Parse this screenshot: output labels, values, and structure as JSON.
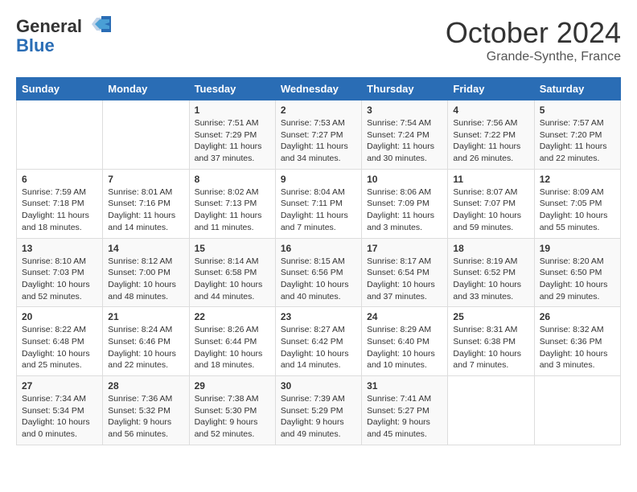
{
  "header": {
    "logo_general": "General",
    "logo_blue": "Blue",
    "title": "October 2024",
    "location": "Grande-Synthe, France"
  },
  "days_of_week": [
    "Sunday",
    "Monday",
    "Tuesday",
    "Wednesday",
    "Thursday",
    "Friday",
    "Saturday"
  ],
  "weeks": [
    [
      null,
      null,
      {
        "day": "1",
        "sunrise": "Sunrise: 7:51 AM",
        "sunset": "Sunset: 7:29 PM",
        "daylight": "Daylight: 11 hours and 37 minutes."
      },
      {
        "day": "2",
        "sunrise": "Sunrise: 7:53 AM",
        "sunset": "Sunset: 7:27 PM",
        "daylight": "Daylight: 11 hours and 34 minutes."
      },
      {
        "day": "3",
        "sunrise": "Sunrise: 7:54 AM",
        "sunset": "Sunset: 7:24 PM",
        "daylight": "Daylight: 11 hours and 30 minutes."
      },
      {
        "day": "4",
        "sunrise": "Sunrise: 7:56 AM",
        "sunset": "Sunset: 7:22 PM",
        "daylight": "Daylight: 11 hours and 26 minutes."
      },
      {
        "day": "5",
        "sunrise": "Sunrise: 7:57 AM",
        "sunset": "Sunset: 7:20 PM",
        "daylight": "Daylight: 11 hours and 22 minutes."
      }
    ],
    [
      {
        "day": "6",
        "sunrise": "Sunrise: 7:59 AM",
        "sunset": "Sunset: 7:18 PM",
        "daylight": "Daylight: 11 hours and 18 minutes."
      },
      {
        "day": "7",
        "sunrise": "Sunrise: 8:01 AM",
        "sunset": "Sunset: 7:16 PM",
        "daylight": "Daylight: 11 hours and 14 minutes."
      },
      {
        "day": "8",
        "sunrise": "Sunrise: 8:02 AM",
        "sunset": "Sunset: 7:13 PM",
        "daylight": "Daylight: 11 hours and 11 minutes."
      },
      {
        "day": "9",
        "sunrise": "Sunrise: 8:04 AM",
        "sunset": "Sunset: 7:11 PM",
        "daylight": "Daylight: 11 hours and 7 minutes."
      },
      {
        "day": "10",
        "sunrise": "Sunrise: 8:06 AM",
        "sunset": "Sunset: 7:09 PM",
        "daylight": "Daylight: 11 hours and 3 minutes."
      },
      {
        "day": "11",
        "sunrise": "Sunrise: 8:07 AM",
        "sunset": "Sunset: 7:07 PM",
        "daylight": "Daylight: 10 hours and 59 minutes."
      },
      {
        "day": "12",
        "sunrise": "Sunrise: 8:09 AM",
        "sunset": "Sunset: 7:05 PM",
        "daylight": "Daylight: 10 hours and 55 minutes."
      }
    ],
    [
      {
        "day": "13",
        "sunrise": "Sunrise: 8:10 AM",
        "sunset": "Sunset: 7:03 PM",
        "daylight": "Daylight: 10 hours and 52 minutes."
      },
      {
        "day": "14",
        "sunrise": "Sunrise: 8:12 AM",
        "sunset": "Sunset: 7:00 PM",
        "daylight": "Daylight: 10 hours and 48 minutes."
      },
      {
        "day": "15",
        "sunrise": "Sunrise: 8:14 AM",
        "sunset": "Sunset: 6:58 PM",
        "daylight": "Daylight: 10 hours and 44 minutes."
      },
      {
        "day": "16",
        "sunrise": "Sunrise: 8:15 AM",
        "sunset": "Sunset: 6:56 PM",
        "daylight": "Daylight: 10 hours and 40 minutes."
      },
      {
        "day": "17",
        "sunrise": "Sunrise: 8:17 AM",
        "sunset": "Sunset: 6:54 PM",
        "daylight": "Daylight: 10 hours and 37 minutes."
      },
      {
        "day": "18",
        "sunrise": "Sunrise: 8:19 AM",
        "sunset": "Sunset: 6:52 PM",
        "daylight": "Daylight: 10 hours and 33 minutes."
      },
      {
        "day": "19",
        "sunrise": "Sunrise: 8:20 AM",
        "sunset": "Sunset: 6:50 PM",
        "daylight": "Daylight: 10 hours and 29 minutes."
      }
    ],
    [
      {
        "day": "20",
        "sunrise": "Sunrise: 8:22 AM",
        "sunset": "Sunset: 6:48 PM",
        "daylight": "Daylight: 10 hours and 25 minutes."
      },
      {
        "day": "21",
        "sunrise": "Sunrise: 8:24 AM",
        "sunset": "Sunset: 6:46 PM",
        "daylight": "Daylight: 10 hours and 22 minutes."
      },
      {
        "day": "22",
        "sunrise": "Sunrise: 8:26 AM",
        "sunset": "Sunset: 6:44 PM",
        "daylight": "Daylight: 10 hours and 18 minutes."
      },
      {
        "day": "23",
        "sunrise": "Sunrise: 8:27 AM",
        "sunset": "Sunset: 6:42 PM",
        "daylight": "Daylight: 10 hours and 14 minutes."
      },
      {
        "day": "24",
        "sunrise": "Sunrise: 8:29 AM",
        "sunset": "Sunset: 6:40 PM",
        "daylight": "Daylight: 10 hours and 10 minutes."
      },
      {
        "day": "25",
        "sunrise": "Sunrise: 8:31 AM",
        "sunset": "Sunset: 6:38 PM",
        "daylight": "Daylight: 10 hours and 7 minutes."
      },
      {
        "day": "26",
        "sunrise": "Sunrise: 8:32 AM",
        "sunset": "Sunset: 6:36 PM",
        "daylight": "Daylight: 10 hours and 3 minutes."
      }
    ],
    [
      {
        "day": "27",
        "sunrise": "Sunrise: 7:34 AM",
        "sunset": "Sunset: 5:34 PM",
        "daylight": "Daylight: 10 hours and 0 minutes."
      },
      {
        "day": "28",
        "sunrise": "Sunrise: 7:36 AM",
        "sunset": "Sunset: 5:32 PM",
        "daylight": "Daylight: 9 hours and 56 minutes."
      },
      {
        "day": "29",
        "sunrise": "Sunrise: 7:38 AM",
        "sunset": "Sunset: 5:30 PM",
        "daylight": "Daylight: 9 hours and 52 minutes."
      },
      {
        "day": "30",
        "sunrise": "Sunrise: 7:39 AM",
        "sunset": "Sunset: 5:29 PM",
        "daylight": "Daylight: 9 hours and 49 minutes."
      },
      {
        "day": "31",
        "sunrise": "Sunrise: 7:41 AM",
        "sunset": "Sunset: 5:27 PM",
        "daylight": "Daylight: 9 hours and 45 minutes."
      },
      null,
      null
    ]
  ]
}
